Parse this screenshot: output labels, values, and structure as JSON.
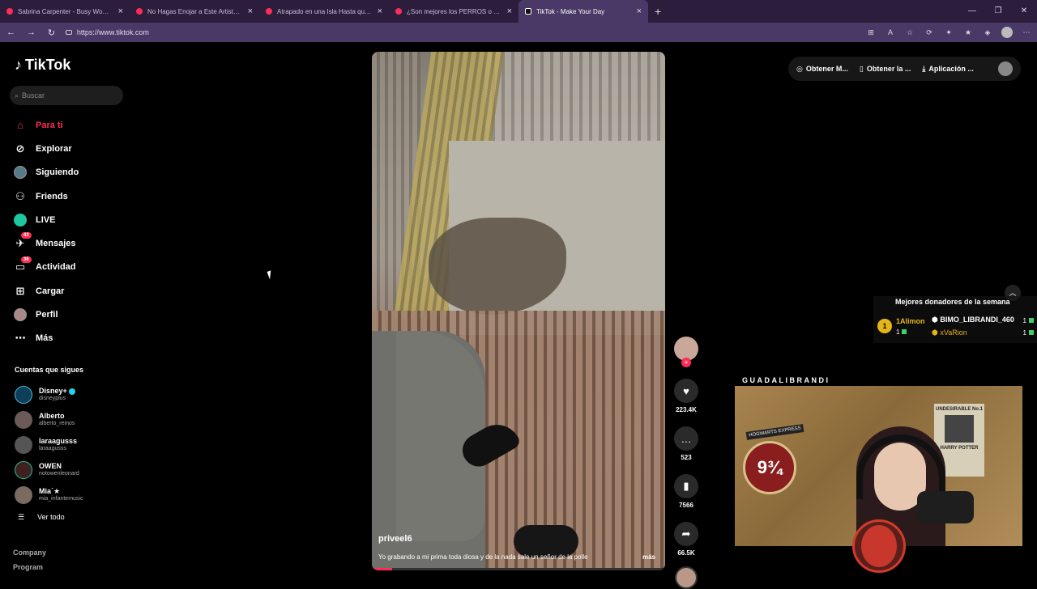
{
  "browser": {
    "tabs": [
      {
        "label": "Sabrina Carpenter - Busy Woman",
        "active": false
      },
      {
        "label": "No Hagas Enojar a Este Artista - Y",
        "active": false
      },
      {
        "label": "Atrapado en una Isla Hasta que G",
        "active": false
      },
      {
        "label": "¿Son mejores los PERROS o GATO",
        "active": false
      },
      {
        "label": "TikTok - Make Your Day",
        "active": true
      }
    ],
    "url": "https://www.tiktok.com"
  },
  "sidebar": {
    "logo": "TikTok",
    "search_placeholder": "Buscar",
    "nav": [
      {
        "label": "Para ti",
        "icon": "home-icon"
      },
      {
        "label": "Explorar",
        "icon": "compass-icon"
      },
      {
        "label": "Siguiendo",
        "icon": "following-icon"
      },
      {
        "label": "Friends",
        "icon": "friends-icon"
      },
      {
        "label": "LIVE",
        "icon": "live-icon"
      },
      {
        "label": "Mensajes",
        "icon": "messages-icon",
        "badge": "43"
      },
      {
        "label": "Actividad",
        "icon": "activity-icon",
        "badge": "36"
      },
      {
        "label": "Cargar",
        "icon": "upload-icon"
      },
      {
        "label": "Perfil",
        "icon": "profile-icon"
      },
      {
        "label": "Más",
        "icon": "more-icon"
      }
    ],
    "following_title": "Cuentas que sigues",
    "following": [
      {
        "name": "Disney+",
        "user": "disneyplus",
        "verified": true
      },
      {
        "name": "Alberto",
        "user": "alberto_reinos"
      },
      {
        "name": "laraagusss",
        "user": "laraagusss"
      },
      {
        "name": "OWEN",
        "user": "notowenleonard"
      },
      {
        "name": "Mia˙★",
        "user": "mia_infantemusic"
      }
    ],
    "see_all": "Ver todo",
    "footer": [
      "Company",
      "Program"
    ]
  },
  "video": {
    "username": "priveel6",
    "description": "Yo grabando a mi prima toda diosa y de la nada sale un señor de la polle",
    "more": "más",
    "progress": 0.07
  },
  "actions": {
    "likes": "223.4K",
    "comments": "523",
    "saves": "7566",
    "shares": "66.5K"
  },
  "topbar": {
    "items": [
      "Obtener M...",
      "Obtener la ...",
      "Aplicación ..."
    ]
  },
  "donors": {
    "title": "Mejores donadores de la semana",
    "rank": "1",
    "list": [
      {
        "name": "1Alimon",
        "count": "1"
      },
      {
        "name": "BIMO_LIBRANDI_460",
        "count": "1"
      },
      {
        "name": "xVaRion",
        "count": "1"
      }
    ]
  },
  "webcam": {
    "label": "GUADALIBRANDI",
    "platform": "9¾",
    "hogwarts": "HOGWARTS EXPRESS",
    "poster_title": "UNDESIRABLE No.1",
    "poster_name": "HARRY POTTER"
  }
}
